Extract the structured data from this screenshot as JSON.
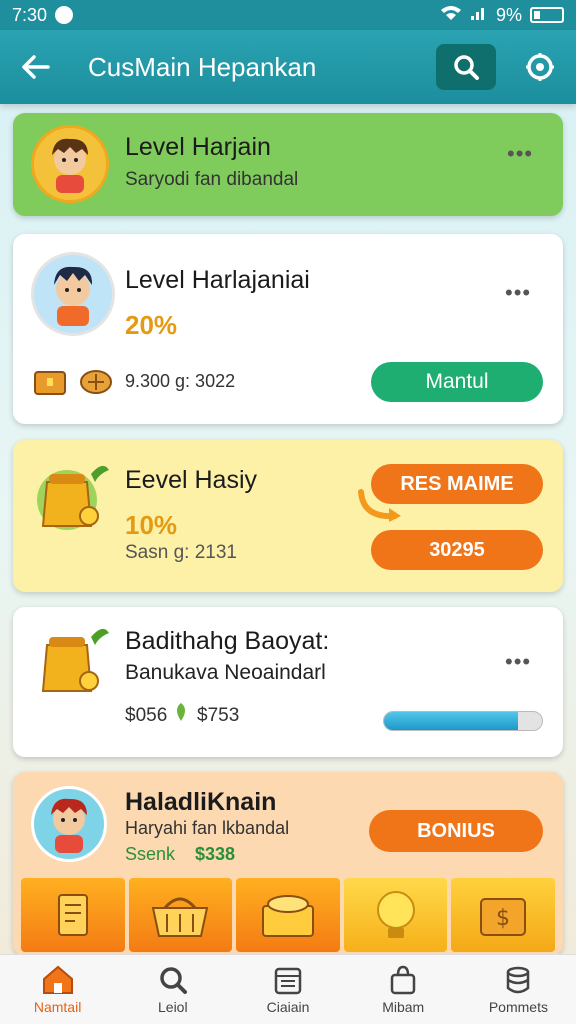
{
  "status_bar": {
    "time": "7:30",
    "battery": "9%"
  },
  "app_bar": {
    "title": "CusMain Hepankan"
  },
  "cards": [
    {
      "title": "Level Harjain",
      "subtitle": "Saryodi fan dibandal"
    },
    {
      "title": "Level Harlajaniai",
      "percent": "20%",
      "stats": "9.300 g: 3022",
      "button": "Mantul"
    },
    {
      "title": "Eevel Hasiy",
      "percent": "10%",
      "stats": "Sasn g: 2131",
      "button_top": "RES MAIME",
      "button_bottom": "30295"
    },
    {
      "title": "Badithahg Baoyat:",
      "subtitle": "Banukava Neoaindarl",
      "stats_left": "$056",
      "stats_right": "$753",
      "progress": 0.85
    },
    {
      "title": "HaladliKnain",
      "subtitle": "Haryahi fan lkbandal",
      "stats_left": "Ssenk",
      "stats_right": "$338",
      "button": "BONIUS"
    }
  ],
  "bottom_nav": [
    {
      "label": "Namtail",
      "icon": "home-icon",
      "active": true
    },
    {
      "label": "Leiol",
      "icon": "search-icon",
      "active": false
    },
    {
      "label": "Ciaiain",
      "icon": "calendar-icon",
      "active": false
    },
    {
      "label": "Mibam",
      "icon": "bag-icon",
      "active": false
    },
    {
      "label": "Pommets",
      "icon": "coins-icon",
      "active": false
    }
  ],
  "colors": {
    "header": "#1f8f9e",
    "card_green": "#7fcb5c",
    "card_yellow": "#fdf1a7",
    "card_peach": "#fcd9b1",
    "accent_orange": "#f07418",
    "accent_green": "#1fae72"
  }
}
